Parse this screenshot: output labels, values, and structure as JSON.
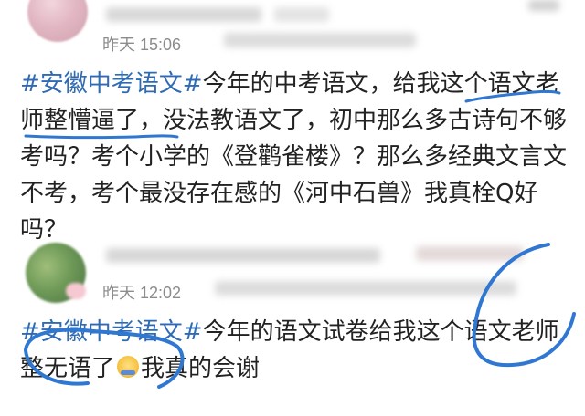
{
  "posts": [
    {
      "time": "昨天 15:06",
      "hashtag": "#安徽中考语文#",
      "body": "今年的中考语文，给我这个语文老师整懵逼了，没法教语文了，初中那么多古诗句不够考吗？考个小学的《登鹳雀楼》？那么多经典文言文不考，考个最没存在感的《河中石兽》我真栓Q好吗？"
    },
    {
      "time": "昨天 12:02",
      "hashtag": "#安徽中考语文#",
      "body_before": "今年的语文试卷给我这个语文老师整无语了",
      "emoji_icon": "speechless-emoji",
      "body_after": "我真的会谢"
    }
  ],
  "colors": {
    "hashtag": "#2f6bb5",
    "text": "#222222",
    "meta": "#8c8c8c",
    "annotation": "#2f77d1"
  }
}
